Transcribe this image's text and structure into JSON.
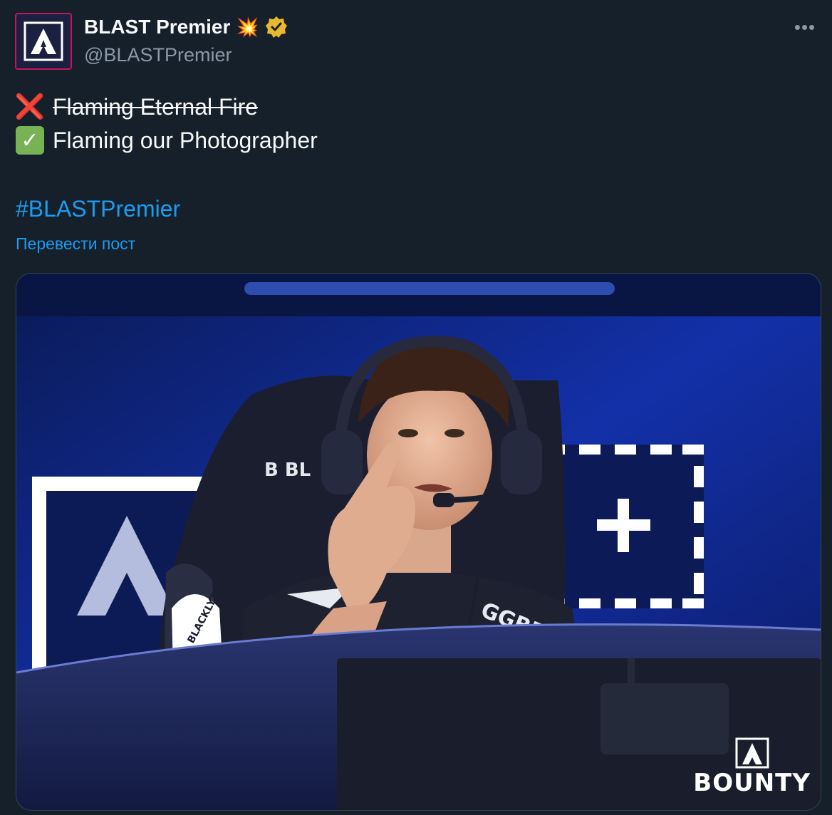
{
  "author": {
    "display_name": "BLAST Premier",
    "name_emoji": "💥",
    "verified": true,
    "handle": "@BLASTPremier",
    "avatar_icon": "blast-logo-icon"
  },
  "menu": {
    "more_label": "•••"
  },
  "content": {
    "line1_emoji": "❌",
    "line1_text": "Flaming Eternal Fire",
    "line2_emoji": "✓",
    "line2_text": "Flaming our Photographer",
    "hashtag": "#BLASTPremier",
    "translate_link": "Перевести пост"
  },
  "media": {
    "watermark": "BOUNTY",
    "chair_brand": "BLACKLYTE",
    "jersey_sponsor": "GGBET"
  },
  "colors": {
    "background": "#15202b",
    "text": "#f7f9f9",
    "muted": "#8b98a5",
    "link": "#1d9bf0",
    "verified_badge": "#e8b82e",
    "avatar_border": "#c2185b"
  }
}
